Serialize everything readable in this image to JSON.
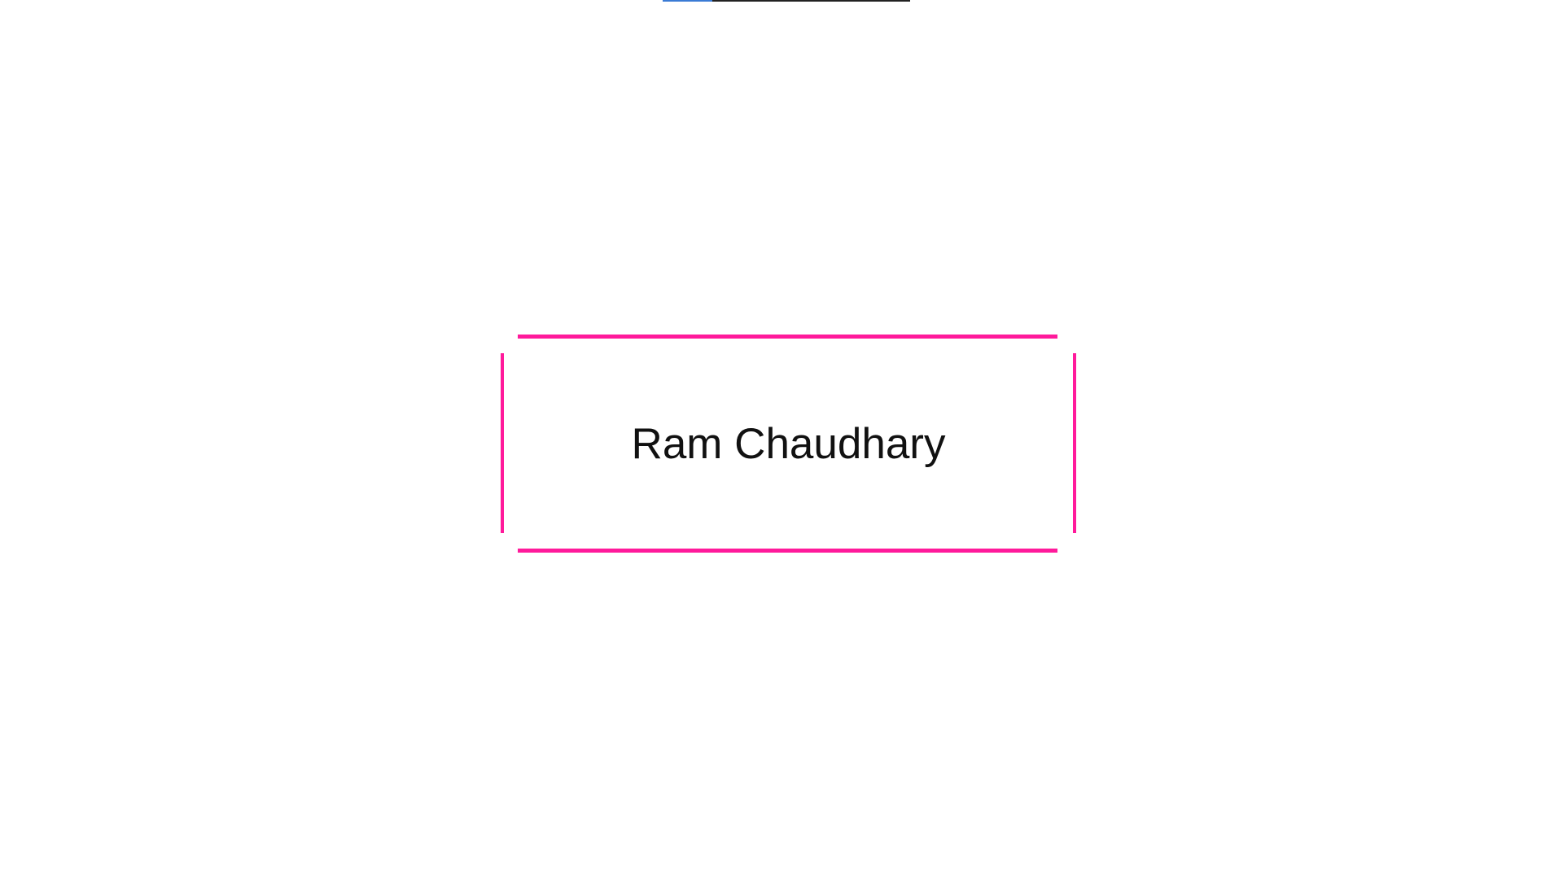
{
  "progress": {
    "fraction": 0.2,
    "fill_color": "#3a7bd5",
    "track_color": "#222222"
  },
  "card": {
    "name": "Ram Chaudhary",
    "border_color": "#ff1a9b"
  }
}
